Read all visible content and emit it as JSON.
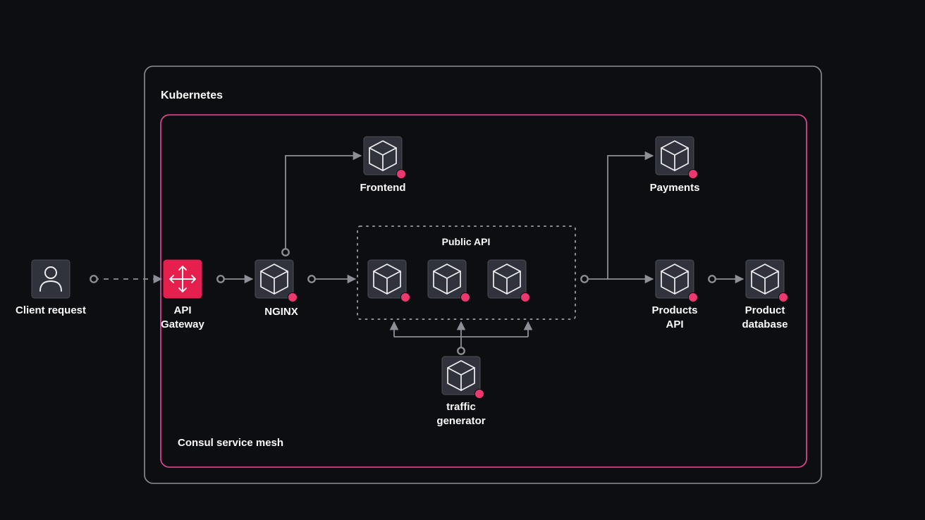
{
  "regions": {
    "kubernetes": "Kubernetes",
    "consul": "Consul service mesh",
    "publicApi": "Public API"
  },
  "nodes": {
    "client": "Client request",
    "gateway_line1": "API",
    "gateway_line2": "Gateway",
    "nginx": "NGINX",
    "frontend": "Frontend",
    "traffic_line1": "traffic",
    "traffic_line2": "generator",
    "payments": "Payments",
    "products_line1": "Products",
    "products_line2": "API",
    "db_line1": "Product",
    "db_line2": "database"
  },
  "colors": {
    "bg": "#0d0e12",
    "nodeFill": "#30333c",
    "nodeStroke": "#4c4e57",
    "gatewayFill": "#e01e5a",
    "pink": "#ff1a75",
    "pinkBorder": "#ec4899",
    "grayBorder": "#8d8f97",
    "dotBorder": "#8d8f97",
    "arrow": "#8d8f97",
    "iconStroke": "#f0f0f2"
  }
}
